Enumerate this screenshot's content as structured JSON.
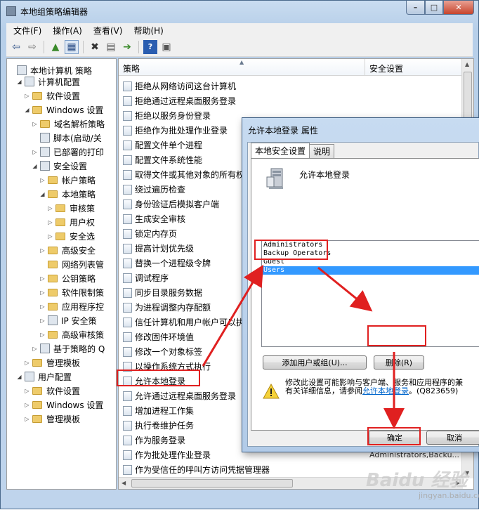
{
  "window": {
    "title": "本地组策略编辑器",
    "min": "–",
    "max": "□",
    "close": "✕"
  },
  "menu": [
    "文件(F)",
    "操作(A)",
    "查看(V)",
    "帮助(H)"
  ],
  "tree": [
    {
      "label": "本地计算机 策略",
      "icon": "computer-policy"
    },
    {
      "label": "计算机配置",
      "icon": "computer"
    },
    {
      "label": "软件设置",
      "icon": "folder"
    },
    {
      "label": "Windows 设置",
      "icon": "folder"
    },
    {
      "label": "域名解析策略",
      "icon": "folder"
    },
    {
      "label": "脚本(启动/关",
      "icon": "script"
    },
    {
      "label": "已部署的打印",
      "icon": "printer"
    },
    {
      "label": "安全设置",
      "icon": "security"
    },
    {
      "label": "帐户策略",
      "icon": "folder"
    },
    {
      "label": "本地策略",
      "icon": "folder"
    },
    {
      "label": "审核策",
      "icon": "folder"
    },
    {
      "label": "用户权",
      "icon": "folder"
    },
    {
      "label": "安全选",
      "icon": "folder"
    },
    {
      "label": "高级安全",
      "icon": "folder"
    },
    {
      "label": "网络列表管",
      "icon": "folder"
    },
    {
      "label": "公钥策略",
      "icon": "folder"
    },
    {
      "label": "软件限制策",
      "icon": "folder"
    },
    {
      "label": "应用程序控",
      "icon": "folder"
    },
    {
      "label": "IP 安全策",
      "icon": "ip-security"
    },
    {
      "label": "高级审核策",
      "icon": "folder"
    },
    {
      "label": "基于策略的 Q",
      "icon": "chart"
    },
    {
      "label": "管理模板",
      "icon": "folder"
    },
    {
      "label": "用户配置",
      "icon": "user"
    },
    {
      "label": "软件设置",
      "icon": "folder"
    },
    {
      "label": "Windows 设置",
      "icon": "folder"
    },
    {
      "label": "管理模板",
      "icon": "folder"
    }
  ],
  "list": {
    "col_policy": "策略",
    "col_setting": "安全设置",
    "rows": [
      {
        "name": "拒绝从网络访问这台计算机",
        "value": ""
      },
      {
        "name": "拒绝通过远程桌面服务登录",
        "value": ""
      },
      {
        "name": "拒绝以服务身份登录",
        "value": ""
      },
      {
        "name": "拒绝作为批处理作业登录",
        "value": ""
      },
      {
        "name": "配置文件单个进程",
        "value": ""
      },
      {
        "name": "配置文件系统性能",
        "value": ""
      },
      {
        "name": "取得文件或其他对象的所有权",
        "value": ""
      },
      {
        "name": "绕过遍历检查",
        "value": ""
      },
      {
        "name": "身份验证后模拟客户端",
        "value": ""
      },
      {
        "name": "生成安全审核",
        "value": ""
      },
      {
        "name": "锁定内存页",
        "value": ""
      },
      {
        "name": "提高计划优先级",
        "value": ""
      },
      {
        "name": "替换一个进程级令牌",
        "value": ""
      },
      {
        "name": "调试程序",
        "value": ""
      },
      {
        "name": "同步目录服务数据",
        "value": ""
      },
      {
        "name": "为进程调整内存配额",
        "value": ""
      },
      {
        "name": "信任计算机和用户帐户可以执",
        "value": ""
      },
      {
        "name": "修改固件环境值",
        "value": ""
      },
      {
        "name": "修改一个对象标签",
        "value": ""
      },
      {
        "name": "以操作系统方式执行",
        "value": ""
      },
      {
        "name": "允许本地登录",
        "value": ""
      },
      {
        "name": "允许通过远程桌面服务登录",
        "value": ""
      },
      {
        "name": "增加进程工作集",
        "value": ""
      },
      {
        "name": "执行卷维护任务",
        "value": ""
      },
      {
        "name": "作为服务登录",
        "value": ""
      },
      {
        "name": "作为批处理作业登录",
        "value": "Administrators,Backu..."
      },
      {
        "name": "作为受信任的呼叫方访问凭据管理器",
        "value": ""
      }
    ]
  },
  "dialog": {
    "title": "允许本地登录 属性",
    "tab_local": "本地安全设置",
    "tab_explain": "说明",
    "policy_name": "允许本地登录",
    "members": [
      "Administrators",
      "Backup Operators",
      "Guest",
      "Users"
    ],
    "selected_member": "Users",
    "add_button": "添加用户或组(U)...",
    "remove_button": "删除(R)",
    "warning_line1": "修改此设置可能影响与客户端、服务和应用程序的兼",
    "warning_line2": "有关详细信息，请参阅",
    "warning_link": "允许本地登录",
    "warning_tail": "。(Q823659)",
    "ok_button": "确定",
    "cancel_button": "取消"
  },
  "watermark": {
    "text": "Baidu 经验",
    "sub": "jingyan.baidu.com"
  }
}
